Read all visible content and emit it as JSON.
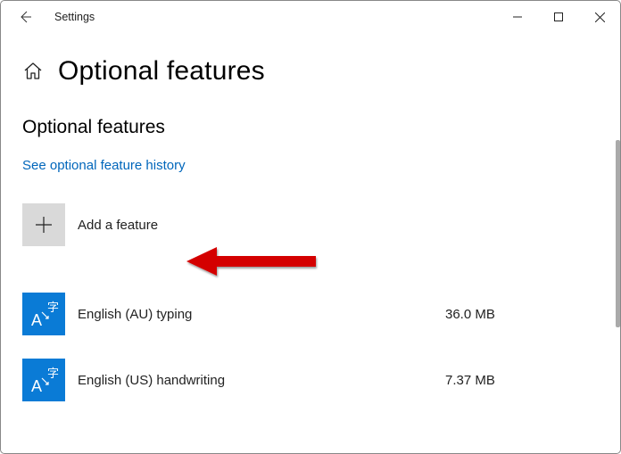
{
  "window": {
    "app_title": "Settings"
  },
  "header": {
    "title": "Optional features"
  },
  "section": {
    "heading": "Optional features",
    "history_link": "See optional feature history",
    "add_label": "Add a feature"
  },
  "features": [
    {
      "name": "English (AU) typing",
      "size": "36.0 MB"
    },
    {
      "name": "English (US) handwriting",
      "size": "7.37 MB"
    }
  ],
  "annotation": {
    "description": "red arrow pointing to Add a feature"
  }
}
